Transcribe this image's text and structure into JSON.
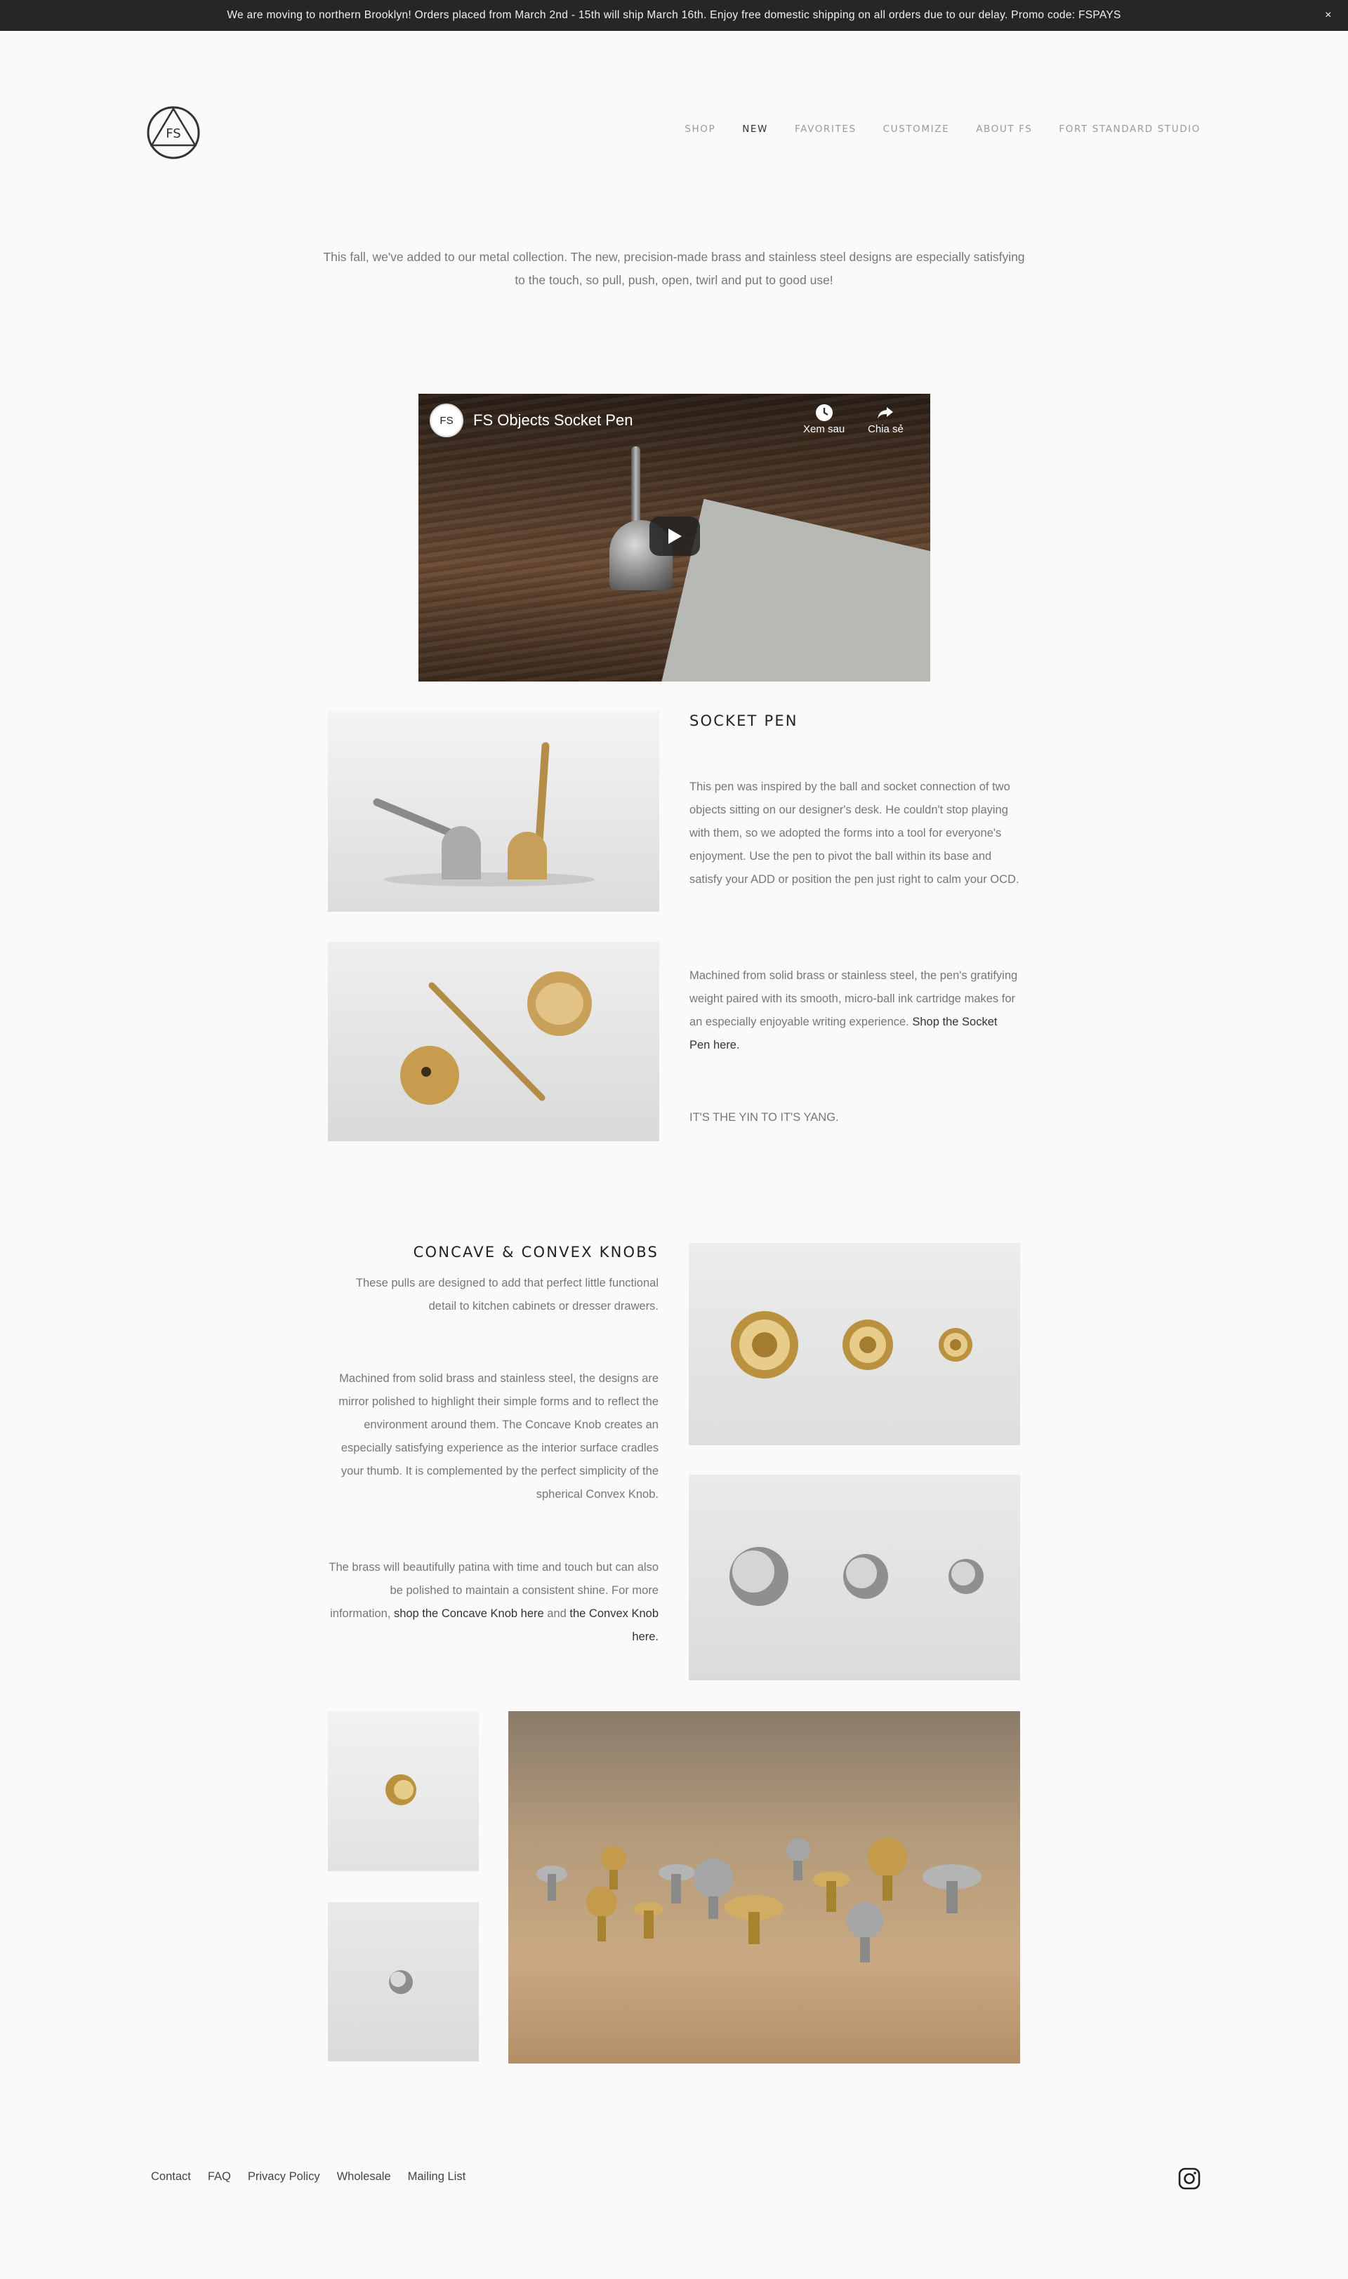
{
  "announcement": {
    "text": "We are moving to northern Brooklyn!  Orders placed from March 2nd - 15th will ship March 16th.  Enjoy free domestic shipping on all orders due to our delay.  Promo code: FSPAYS",
    "close": "×"
  },
  "logo": {
    "text": "FS"
  },
  "nav": [
    {
      "label": "SHOP"
    },
    {
      "label": "NEW"
    },
    {
      "label": "FAVORITES"
    },
    {
      "label": "CUSTOMIZE"
    },
    {
      "label": "ABOUT FS"
    },
    {
      "label": "FORT STANDARD STUDIO"
    }
  ],
  "intro": "This fall, we've added to our metal collection. The new, precision-made brass and stainless steel designs are especially satisfying to the touch, so pull, push, open, twirl and put to good use!",
  "video": {
    "channel_logo": "FS",
    "title": "FS Objects Socket Pen",
    "watch_later": "Xem sau",
    "share": "Chia sẻ"
  },
  "socket_pen": {
    "title": "SOCKET PEN",
    "p1": "This pen was inspired by the ball and socket connection of two objects sitting on our designer's desk.  He couldn't stop playing with them, so we adopted the forms into a tool for everyone's enjoyment.  Use the pen to pivot the ball within its base and satisfy your ADD or position the pen just right to calm your OCD.",
    "p2": "Machined from solid brass or stainless steel, the pen's gratifying weight paired with its smooth, micro-ball ink cartridge makes for an especially enjoyable writing experience.",
    "p2_link": "Shop the Socket Pen here.",
    "p3": "IT'S THE YIN TO IT'S YANG."
  },
  "knobs": {
    "title": "CONCAVE & CONVEX KNOBS",
    "p1": "These pulls are designed to add that perfect little functional detail to kitchen cabinets or dresser drawers.",
    "p2": "Machined from solid brass and stainless steel, the designs are mirror polished to highlight their simple forms and to reflect the environment around them.  The Concave Knob creates  an especially satisfying experience as the interior surface cradles your thumb.  It is complemented by the perfect simplicity of the spherical Convex Knob.",
    "p3_a": "The brass will beautifully patina with time and touch but can also be polished to maintain a consistent shine. For more information,",
    "p3_link1": "shop the Concave Knob here",
    "p3_b": "and",
    "p3_link2": "the Convex Knob here."
  },
  "footer": [
    {
      "label": "Contact"
    },
    {
      "label": "FAQ"
    },
    {
      "label": "Privacy Policy"
    },
    {
      "label": "Wholesale"
    },
    {
      "label": "Mailing List"
    }
  ],
  "colors": {
    "announcement_bg": "#262626",
    "page_bg": "#fafafa",
    "text": "#777777",
    "heading": "#222222"
  }
}
